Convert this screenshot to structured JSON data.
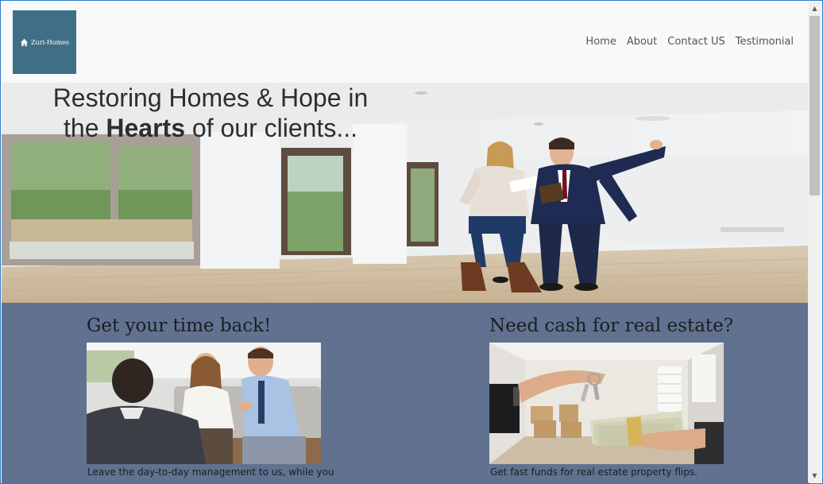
{
  "brand": {
    "logo_text": "Zuri-Homes",
    "logo_icon": "house-icon",
    "logo_color": "#3f6f86"
  },
  "nav": {
    "items": [
      {
        "label": "Home"
      },
      {
        "label": "About"
      },
      {
        "label": "Contact US"
      },
      {
        "label": "Testimonial"
      }
    ]
  },
  "hero": {
    "line1": "Restoring Homes & Hope in",
    "line2_pre": "the ",
    "line2_bold": "Hearts",
    "line2_post": " of our clients..."
  },
  "cards": [
    {
      "title": "Get your time back!",
      "text": "Leave the day-to-day management to us, while you",
      "image": "couple-meeting-agent-photo"
    },
    {
      "title": "Need cash for real estate?",
      "text": "Get fast funds for real estate property flips.",
      "image": "keys-and-cash-exchange-photo"
    }
  ],
  "colors": {
    "section_bg": "#617290",
    "header_bg": "#f8f9fa",
    "window_border": "#2d7ac6"
  }
}
